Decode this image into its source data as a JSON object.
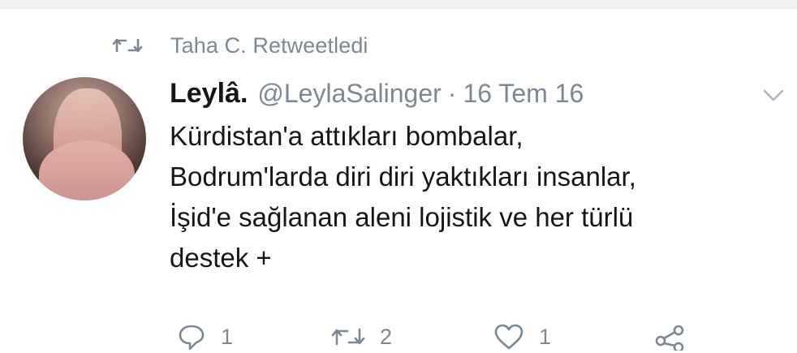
{
  "retweet": {
    "label": "Taha C. Retweetledi",
    "icon": "retweet-icon"
  },
  "tweet": {
    "name": "Leylâ.",
    "handle": "@LeylaSalinger",
    "separator": "·",
    "date": "16 Tem 16",
    "lines": [
      "Kürdistan'a attıkları bombalar,",
      "Bodrum'larda diri diri yaktıkları insanlar,",
      "İşid'e sağlanan aleni lojistik ve her türlü",
      "destek +"
    ]
  },
  "actions": {
    "reply": {
      "icon": "reply-icon",
      "count": "1"
    },
    "retweet": {
      "icon": "retweet-icon",
      "count": "2"
    },
    "like": {
      "icon": "heart-icon",
      "count": "1"
    },
    "share": {
      "icon": "share-icon"
    }
  },
  "colors": {
    "text": "#14171a",
    "muted": "#7c8893",
    "background": "#ffffff"
  }
}
